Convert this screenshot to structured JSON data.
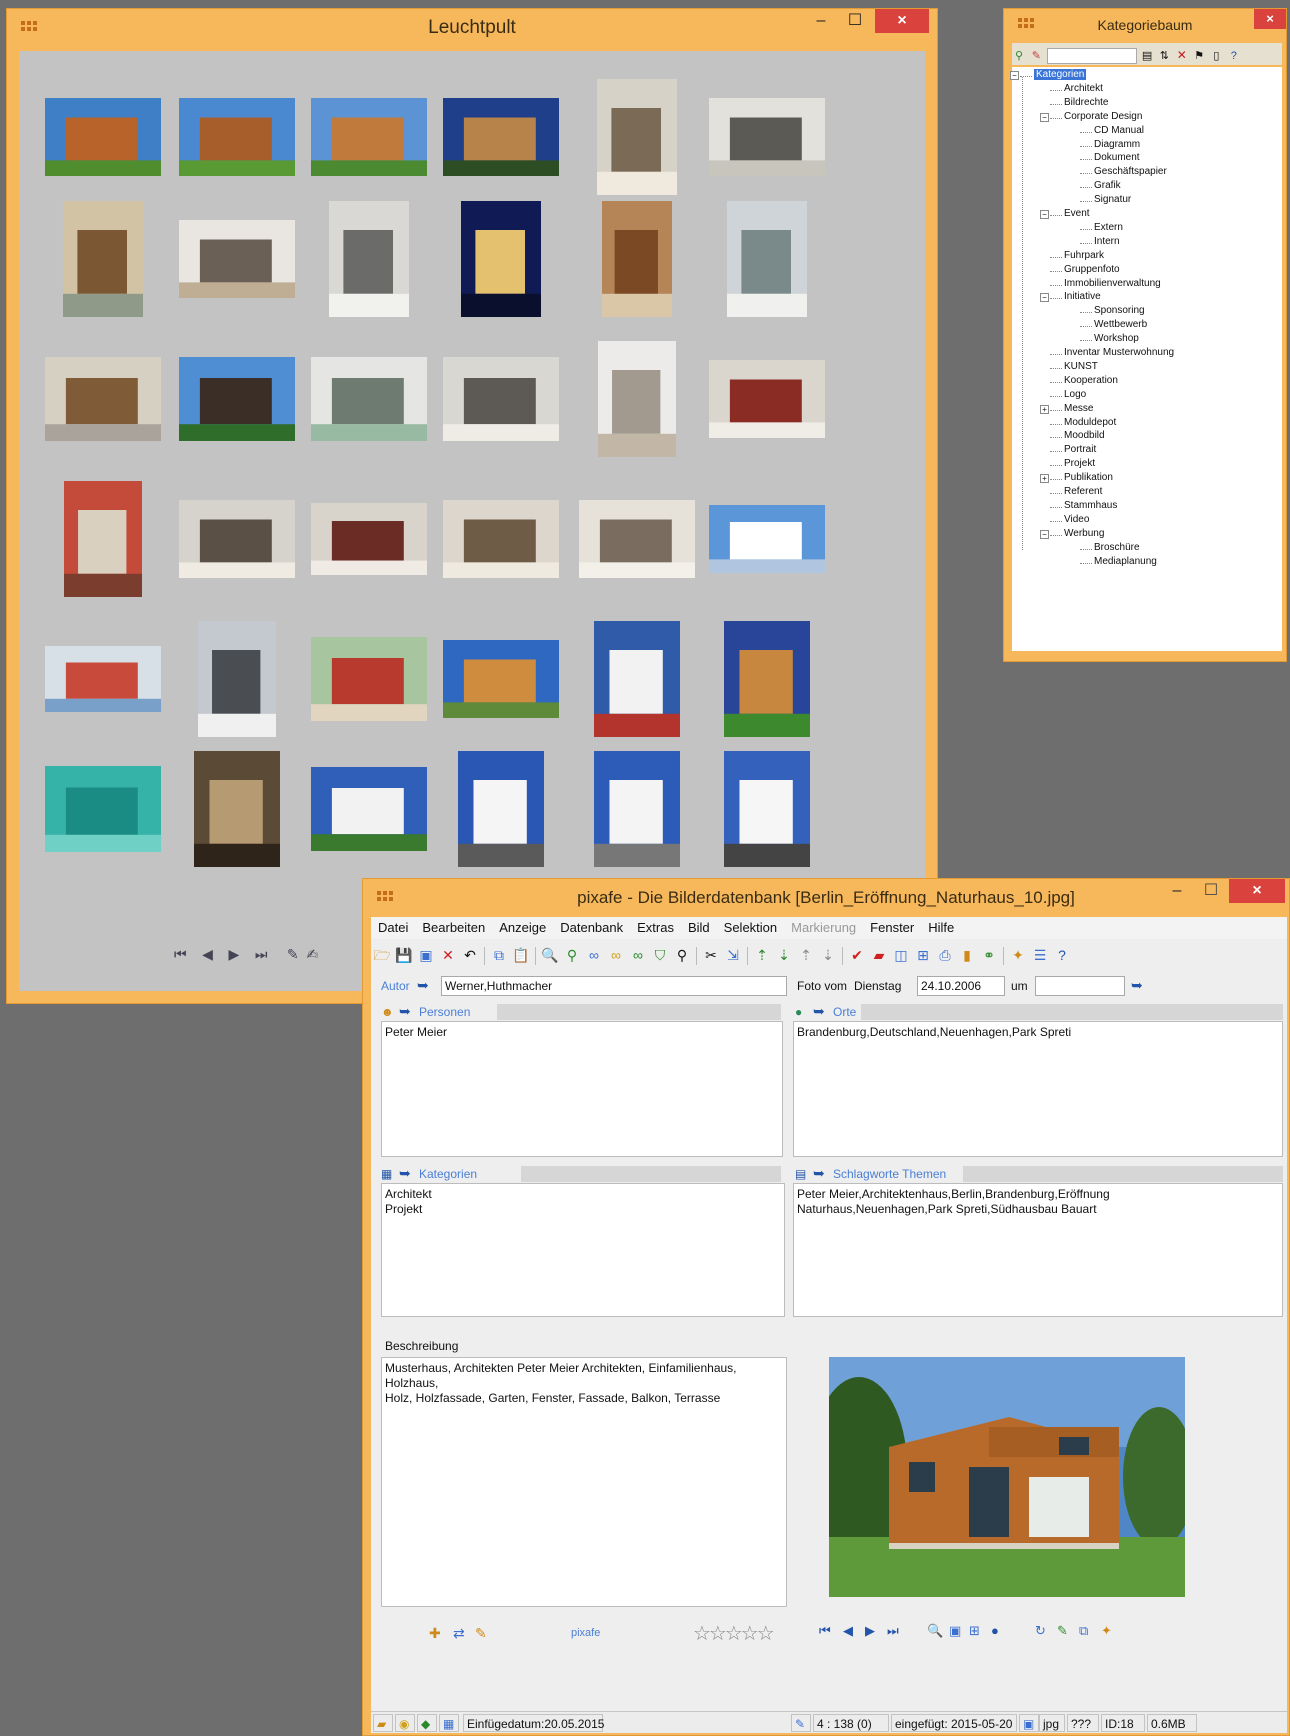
{
  "lighttable": {
    "title": "Leuchtpult",
    "minimize": "–",
    "maximize": "☐",
    "close": "×",
    "thumbnails_count": 36
  },
  "category_tree": {
    "title": "Kategoriebaum",
    "close": "×",
    "nodes": [
      {
        "label": "Kategorien",
        "level": 0,
        "expander": "⊟",
        "selected": true
      },
      {
        "label": "Architekt",
        "level": 1
      },
      {
        "label": "Bildrechte",
        "level": 1
      },
      {
        "label": "Corporate Design",
        "level": 1,
        "expander": "⊟"
      },
      {
        "label": "CD Manual",
        "level": 2
      },
      {
        "label": "Diagramm",
        "level": 2
      },
      {
        "label": "Dokument",
        "level": 2
      },
      {
        "label": "Geschäftspapier",
        "level": 2
      },
      {
        "label": "Grafik",
        "level": 2
      },
      {
        "label": "Signatur",
        "level": 2
      },
      {
        "label": "Event",
        "level": 1,
        "expander": "⊟"
      },
      {
        "label": "Extern",
        "level": 2
      },
      {
        "label": "Intern",
        "level": 2
      },
      {
        "label": "Fuhrpark",
        "level": 1
      },
      {
        "label": "Gruppenfoto",
        "level": 1
      },
      {
        "label": "Immobilienverwaltung",
        "level": 1
      },
      {
        "label": "Initiative",
        "level": 1,
        "expander": "⊟"
      },
      {
        "label": "Sponsoring",
        "level": 2
      },
      {
        "label": "Wettbewerb",
        "level": 2
      },
      {
        "label": "Workshop",
        "level": 2
      },
      {
        "label": "Inventar Musterwohnung",
        "level": 1
      },
      {
        "label": "KUNST",
        "level": 1
      },
      {
        "label": "Kooperation",
        "level": 1
      },
      {
        "label": "Logo",
        "level": 1
      },
      {
        "label": "Messe",
        "level": 1,
        "expander": "⊞"
      },
      {
        "label": "Moduldepot",
        "level": 1
      },
      {
        "label": "Moodbild",
        "level": 1
      },
      {
        "label": "Portrait",
        "level": 1
      },
      {
        "label": "Projekt",
        "level": 1
      },
      {
        "label": "Publikation",
        "level": 1,
        "expander": "⊞"
      },
      {
        "label": "Referent",
        "level": 1
      },
      {
        "label": "Stammhaus",
        "level": 1
      },
      {
        "label": "Video",
        "level": 1
      },
      {
        "label": "Werbung",
        "level": 1,
        "expander": "⊟"
      },
      {
        "label": "Broschüre",
        "level": 2
      },
      {
        "label": "Mediaplanung",
        "level": 2
      }
    ]
  },
  "main": {
    "title": "pixafe - Die Bilderdatenbank  [Berlin_Eröffnung_Naturhaus_10.jpg]",
    "minimize": "–",
    "maximize": "☐",
    "close": "×",
    "menu": [
      "Datei",
      "Bearbeiten",
      "Anzeige",
      "Datenbank",
      "Extras",
      "Bild",
      "Selektion",
      "Markierung",
      "Fenster",
      "Hilfe"
    ],
    "author_label": "Autor",
    "author_value": "Werner,Huthmacher",
    "photo_label": "Foto vom",
    "weekday": "Dienstag",
    "date": "24.10.2006",
    "time_label": "um",
    "persons_label": "Personen",
    "persons_value": "Peter Meier",
    "places_label": "Orte",
    "places_value": "Brandenburg,Deutschland,Neuenhagen,Park Spreti",
    "categories_label": "Kategorien",
    "categories_value": "Architekt\nProjekt",
    "keywords_label": "Schlagworte Themen",
    "keywords_value": "Peter Meier,Architektenhaus,Berlin,Brandenburg,Eröffnung\nNaturhaus,Neuenhagen,Park Spreti,Südhausbau Bauart",
    "description_label": "Beschreibung",
    "description_value": "Musterhaus, Architekten Peter Meier Architekten, Einfamilienhaus, Holzhaus,\nHolz, Holzfassade, Garten, Fenster, Fassade, Balkon, Terrasse",
    "pixafe_link": "pixafe",
    "rating_stars": "☆☆☆☆☆",
    "status": {
      "insert_date": "Einfügedatum:20.05.2015",
      "count": "4 : 138 (0)",
      "inserted": "eingefügt: 2015-05-20",
      "ext": "jpg",
      "unknown": "???",
      "id": "ID:18",
      "size": "0.6MB"
    }
  }
}
